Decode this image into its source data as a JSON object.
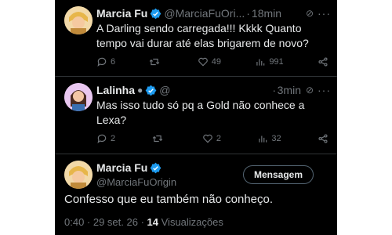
{
  "tweets": [
    {
      "name": "Marcia Fu",
      "handle": "@MarciaFuOri...",
      "time": "18min",
      "text_line1": "A Darling sendo carregada!!! Kkkk Quanto",
      "text_line2": "tempo vai durar até elas brigarem de novo?",
      "replies": "6",
      "retweets": "",
      "likes": "49",
      "views": "991"
    },
    {
      "name": "Lalinha",
      "handle": "@",
      "time": "3min",
      "text_line1": "Mas isso tudo só pq a Gold não conhece a",
      "text_line2": "Lexa?",
      "replies": "2",
      "retweets": "",
      "likes": "2",
      "views": "32"
    }
  ],
  "main_tweet": {
    "name": "Marcia Fu",
    "handle": "@MarciaFuOrigin",
    "button_label": "Mensagem",
    "text": "Confesso que eu também não conheço.",
    "timestamp": "0:40 · 29 set. 26 ·",
    "views_count": "14",
    "views_label": "Visualizações"
  },
  "separator_dot": "·",
  "more_glyph": "···",
  "colors": {
    "background": "#000000",
    "text": "#e7e9ea",
    "muted": "#71767b",
    "verified": "#1d9bf0",
    "divider": "#2f3336"
  },
  "icons": [
    "reply-icon",
    "retweet-icon",
    "like-icon",
    "views-icon",
    "share-icon",
    "verified-badge-icon",
    "grok-icon",
    "more-icon"
  ]
}
